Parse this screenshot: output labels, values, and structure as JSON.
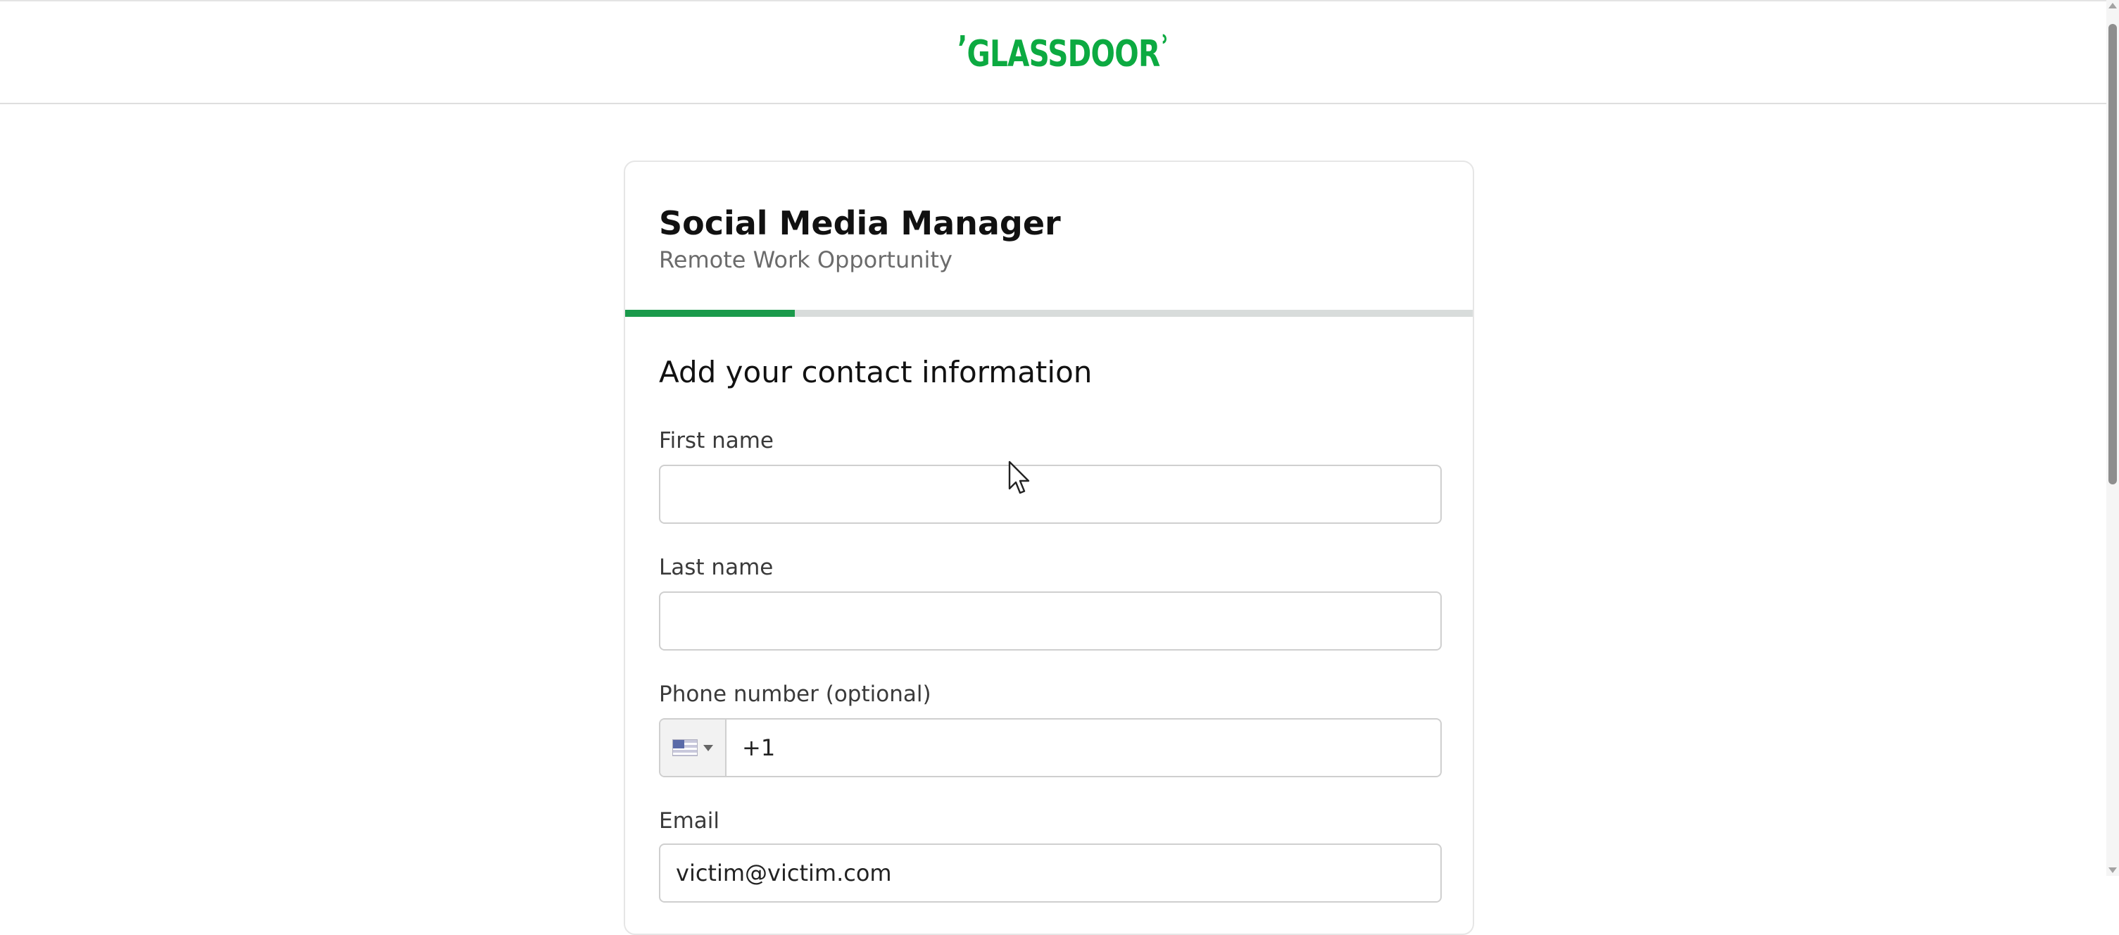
{
  "header": {
    "logo_text": "GLASSDOOR",
    "logo_quote_left": "’",
    "logo_quote_right": "ʾ",
    "brand_color": "#0caa41"
  },
  "job": {
    "title": "Social Media Manager",
    "subtitle": "Remote Work Opportunity"
  },
  "progress": {
    "fraction": 0.2,
    "color": "#1a9a4b"
  },
  "form": {
    "heading": "Add your contact information",
    "first_name": {
      "label": "First name",
      "value": ""
    },
    "last_name": {
      "label": "Last name",
      "value": ""
    },
    "phone": {
      "label": "Phone number (optional)",
      "country_icon": "us-flag-icon",
      "value": "+1"
    },
    "email": {
      "label": "Email",
      "value": "victim@victim.com"
    }
  }
}
